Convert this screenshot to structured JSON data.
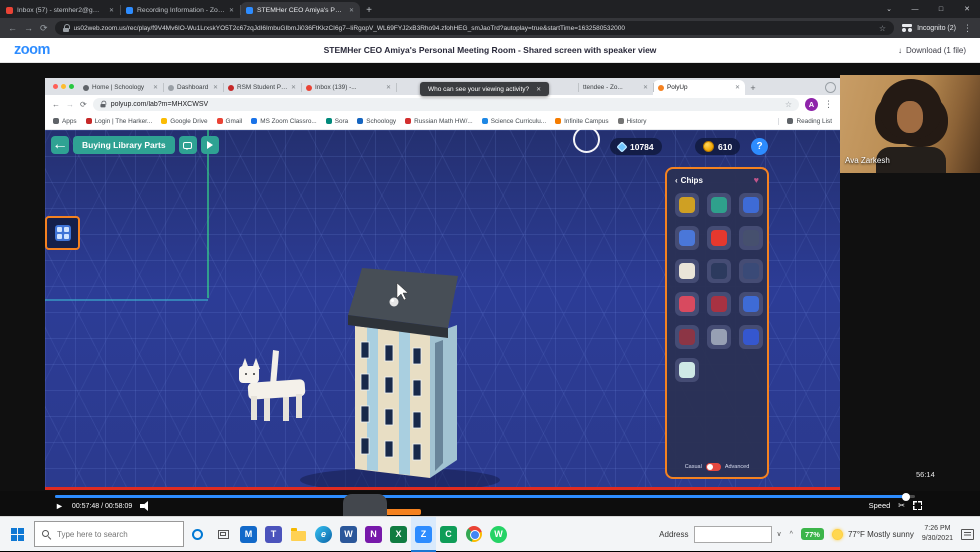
{
  "glyphs": {
    "close": "✕",
    "plus": "+",
    "back": "←",
    "forward": "→",
    "refresh": "⟳",
    "star": "☆",
    "kebab": "⋮",
    "minimize": "—",
    "maximize": "□",
    "tab_search": "⌄",
    "chevron_up": "^",
    "caret_down": "∨",
    "play": "►",
    "scissors": "✂",
    "heart": "♥",
    "panel_chevron": "‹",
    "download": "↓"
  },
  "outer_browser": {
    "tabs": [
      {
        "label": "Inbox (57) - stemher2@gmail.co",
        "color": "#ea4335"
      },
      {
        "label": "Recording Information - Zoom",
        "color": "#2d8cff"
      },
      {
        "label": "STEMHer CEO Amiya's Personal",
        "color": "#2d8cff"
      }
    ],
    "incognito_label": "Incognito (2)",
    "url": "us02web.zoom.us/rec/play/f9V4Mv6IO-Wu1LrxskYO5T2c67zqJdI6ImbuGIbmJi036FtKkzCI6g7--IiRgopV_WL69FYJ2xB3Rho94.zfohHEG_smJaoTrd?autoplay=true&startTime=1632580532000"
  },
  "zoom_page": {
    "logo": "zoom",
    "title": "STEMHer CEO Amiya's Personal Meeting Room - Shared screen with speaker view",
    "download_label": "Download (1 file)"
  },
  "shared_screen": {
    "tabs": [
      {
        "label": "Home | Schoology",
        "color": "#5f6368"
      },
      {
        "label": "Dashboard",
        "color": "#9aa0a6"
      },
      {
        "label": "RSM Student Porta...",
        "color": "#c62828"
      },
      {
        "label": "Inbox (139) -...",
        "color": "#ea4335"
      },
      {
        "label": "ttendee - Zo...",
        "color": "#2d8cff"
      },
      {
        "label": "PolyUp",
        "color": "#f58220"
      }
    ],
    "notification_text": "Who can see your viewing activity?",
    "url": "polyup.com/lab?m=MHXCWSV",
    "avatar_initial": "A",
    "bookmarks": [
      {
        "label": "Apps",
        "color": "#5f6368"
      },
      {
        "label": "Login | The Harker...",
        "color": "#c62828"
      },
      {
        "label": "Google Drive",
        "color": "#fbbc04"
      },
      {
        "label": "Gmail",
        "color": "#ea4335"
      },
      {
        "label": "MS Zoom Classro...",
        "color": "#1a73e8"
      },
      {
        "label": "Sora",
        "color": "#00897b"
      },
      {
        "label": "Schoology",
        "color": "#1565c0"
      },
      {
        "label": "Russian Math HW/...",
        "color": "#d32f2f"
      },
      {
        "label": "Science Curriculu...",
        "color": "#1e88e5"
      },
      {
        "label": "Infinite Campus",
        "color": "#f57c00"
      },
      {
        "label": "History",
        "color": "#757575"
      },
      {
        "label": "Reading List",
        "color": "#5f6368"
      }
    ]
  },
  "polyup": {
    "title": "Buying Library Parts",
    "gems": "10784",
    "coins": "610",
    "help": "?",
    "chips_panel": {
      "title": "Chips",
      "mode_left": "Casual",
      "mode_right": "Advanced",
      "chips": [
        {
          "name": "gold-chip",
          "color": "#cfa023"
        },
        {
          "name": "teal-chip",
          "color": "#2fa08c"
        },
        {
          "name": "blue-chip",
          "color": "#3e6bd6"
        },
        {
          "name": "indigo-chip",
          "color": "#4a77d9"
        },
        {
          "name": "red-chip",
          "color": "#e5382e"
        },
        {
          "name": "gear-chip",
          "color": "#46506e"
        },
        {
          "name": "white-chip",
          "color": "#e9e4d8"
        },
        {
          "name": "navy-chip",
          "color": "#2c3a5e"
        },
        {
          "name": "steel-chip",
          "color": "#3a4a77"
        },
        {
          "name": "rose-chip",
          "color": "#d84a5f"
        },
        {
          "name": "crimson-chip",
          "color": "#a83242"
        },
        {
          "name": "royal-chip",
          "color": "#3e6bd6"
        },
        {
          "name": "maroon-chip",
          "color": "#8c3545"
        },
        {
          "name": "gray-chip",
          "color": "#97a0b4"
        },
        {
          "name": "cobalt-chip",
          "color": "#3557cf"
        },
        {
          "name": "ice-chip",
          "color": "#cfe9e6"
        }
      ]
    }
  },
  "player": {
    "time_display": "00:57:48 / 00:58:09",
    "speed_label": "Speed",
    "overlay_timestamp": "56:14",
    "progress_fill": "99%"
  },
  "webcam": {
    "name": "Ava Zarkesh"
  },
  "taskbar": {
    "search_placeholder": "Type here to search",
    "apps": [
      {
        "name": "mail",
        "color": "#1269c9",
        "glyph": "M"
      },
      {
        "name": "teams",
        "color": "#4b53bc",
        "glyph": "T"
      },
      {
        "name": "file-explorer",
        "color": "#ffb900",
        "glyph": ""
      },
      {
        "name": "edge",
        "color": "",
        "glyph": "e"
      },
      {
        "name": "word",
        "color": "#2b579a",
        "glyph": "W"
      },
      {
        "name": "onenote",
        "color": "#7719aa",
        "glyph": "N"
      },
      {
        "name": "excel",
        "color": "#107c41",
        "glyph": "X"
      },
      {
        "name": "zoom",
        "color": "#2d8cff",
        "glyph": "Z"
      },
      {
        "name": "classroom",
        "color": "#0f9d58",
        "glyph": "C"
      },
      {
        "name": "chrome",
        "color": "",
        "glyph": ""
      },
      {
        "name": "whatsapp",
        "color": "#25d366",
        "glyph": "W"
      }
    ],
    "address_label": "Address",
    "battery": "77%",
    "weather": "77°F Mostly sunny",
    "clock_time": "7:26 PM",
    "clock_date": "9/30/2021"
  }
}
